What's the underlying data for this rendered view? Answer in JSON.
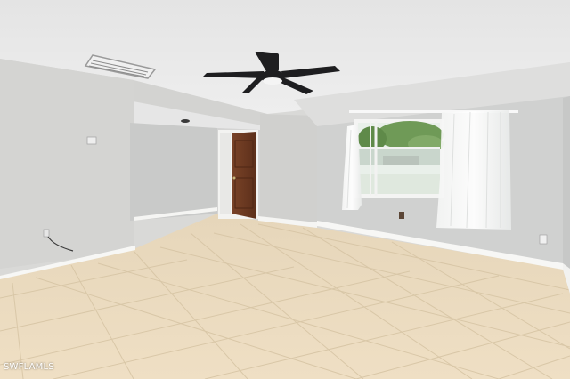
{
  "photo": {
    "watermark": "SWFLAMLS",
    "colors": {
      "ceiling": "#eaeaea",
      "wall": "#d2d2d0",
      "floor_tile": "#ead9bd",
      "door": "#6e3b22",
      "fan": "#1e1e20",
      "baseboard": "#f6f6f4"
    }
  }
}
